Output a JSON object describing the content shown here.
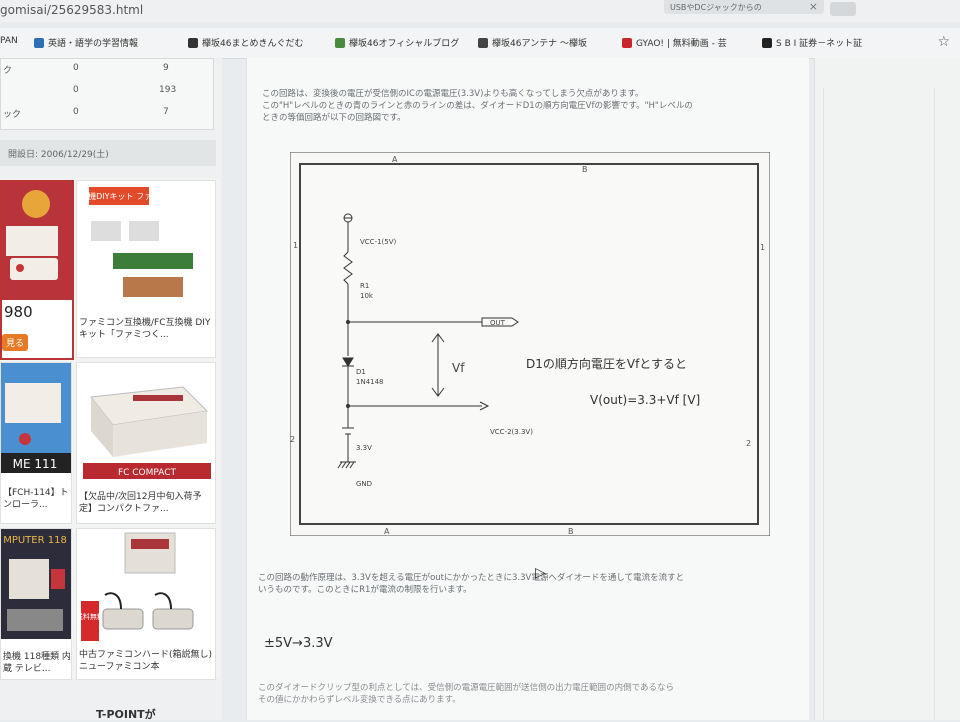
{
  "browser": {
    "url_fragment": "gomisai/25629583.html",
    "tab_title": "USBやDCジャックからの",
    "tab_close": "×",
    "bookmarks": [
      {
        "label": "PAN",
        "color": "#2f6db5"
      },
      {
        "label": "英語・語学の学習情報",
        "color": "#2f6db5"
      },
      {
        "label": "欅坂46まとめきんぐだむ",
        "color": "#333333"
      },
      {
        "label": "欅坂46オフィシャルブログ",
        "color": "#4a8a3c"
      },
      {
        "label": "欅坂46アンテナ ～欅坂",
        "color": "#444444"
      },
      {
        "label": "GYAO! | 無料動画 - 芸",
        "color": "#c8262d"
      },
      {
        "label": "S B I 証券－ネット証",
        "color": "#222222"
      }
    ],
    "star": "☆"
  },
  "sidebar": {
    "stats": [
      {
        "label": "ク",
        "a": "0",
        "b": "9"
      },
      {
        "label": "",
        "a": "0",
        "b": "193"
      },
      {
        "label": "ック",
        "a": "0",
        "b": "7"
      }
    ],
    "open_date": "開設日: 2006/12/29(土)",
    "ads": [
      {
        "title": "980",
        "button": "見る"
      },
      {
        "title": "ファミコン互換機/FC互換機 DIYキット「ファミつく...",
        "banner": "FC互換機DIYキット ファミつく"
      },
      {
        "title": "【FCH-114】トンローラ...",
        "banner": "ME 111"
      },
      {
        "title": "【欠品中/次回12月中旬入荷予定】コンパクトファ...",
        "banner": "FC COMPACT"
      },
      {
        "title": "換機 118種類 内蔵 テレビ...",
        "banner": "MPUTER 118"
      },
      {
        "title": "中古ファミコンハード(箱説無し)ニューファミコン本",
        "banner": "送料無料"
      }
    ],
    "footer_text": "T-POINTが"
  },
  "article": {
    "intro_lines": [
      "この回路は、変換後の電圧が受信側のICの電源電圧(3.3V)よりも高くなってしまう欠点があります。",
      "この\"H\"レベルのときの青のラインと赤のラインの差は、ダイオードD1の順方向電圧Vfの影響です。\"H\"レベルの",
      "ときの等価回路が以下の回路図です。"
    ],
    "schematic": {
      "frame_labels": {
        "top_a": "A",
        "top_b": "B",
        "bottom_a": "A",
        "bottom_b": "B",
        "left_1": "1",
        "left_2": "2",
        "right_1": "1",
        "right_2": "2"
      },
      "vcc1": "VCC-1(5V)",
      "r1_name": "R1",
      "r1_value": "10k",
      "out_label": "OUT",
      "vf_label": "Vf",
      "d1_name": "D1",
      "d1_part": "1N4148",
      "vcc2": "VCC-2(3.3V)",
      "v33": "3.3V",
      "gnd": "GND",
      "note1": "D1の順方向電圧をVfとすると",
      "note2": "V(out)=3.3+Vf [V]"
    },
    "after_lines": [
      "この回路の動作原理は、3.3Vを超える電圧がoutにかかったときに3.3V電源へダイオードを通して電流を流すと",
      "いうものです。このときにR1が電流の制限を行います。"
    ],
    "heading": "±5V→3.3V",
    "bottom_lines": [
      "このダイオードクリップ型の利点としては、受信側の電源電圧範囲が送信側の出力電圧範囲の内側であるなら",
      "その値にかかわらずレベル変換できる点にあります。"
    ]
  }
}
